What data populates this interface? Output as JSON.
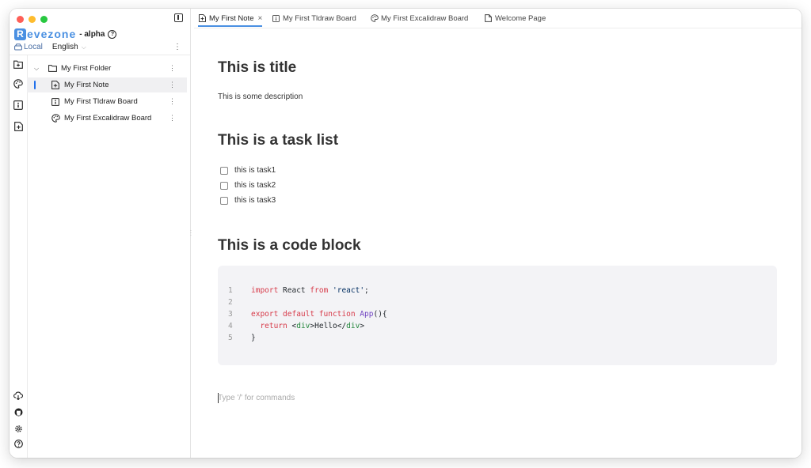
{
  "app": {
    "logo_letter": "R",
    "logo_rest": "evezone",
    "edition": "- alpha",
    "brand_color": "#4a90e2"
  },
  "storage": {
    "mode": "Local",
    "language": "English"
  },
  "tree": [
    {
      "label": "My First Folder",
      "icon": "folder-icon",
      "type": "folder"
    },
    {
      "label": "My First Note",
      "icon": "note-icon",
      "type": "note",
      "active": true
    },
    {
      "label": "My First Tldraw Board",
      "icon": "tldraw-icon",
      "type": "tldraw"
    },
    {
      "label": "My First Excalidraw Board",
      "icon": "palette-icon",
      "type": "excalidraw"
    }
  ],
  "tabs": [
    {
      "label": "My First Note",
      "icon": "note-icon",
      "active": true,
      "close": "×"
    },
    {
      "label": "My First Tldraw Board",
      "icon": "tldraw-icon"
    },
    {
      "label": "My First Excalidraw Board",
      "icon": "palette-icon"
    },
    {
      "label": "Welcome Page",
      "icon": "page-icon"
    }
  ],
  "doc": {
    "title": "This is title",
    "description": "This is some description",
    "task_heading": "This is a task list",
    "tasks": [
      "this is task1",
      "this is task2",
      "this is task3"
    ],
    "code_heading": "This is a code block",
    "code_lines": [
      "1",
      "2",
      "3",
      "4",
      "5"
    ],
    "placeholder": "Type '/' for commands"
  }
}
